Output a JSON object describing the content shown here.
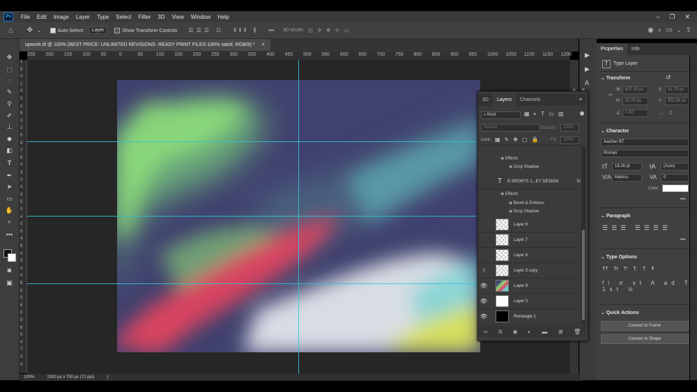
{
  "app": {
    "logo": "Ps"
  },
  "menu": [
    "File",
    "Edit",
    "Image",
    "Layer",
    "Type",
    "Select",
    "Filter",
    "3D",
    "View",
    "Window",
    "Help"
  ],
  "options": {
    "auto_select_label": "Auto-Select:",
    "auto_select_value": "Layer",
    "transform_controls_label": "Show Transform Controls",
    "mode_3d_label": "3D Mode:"
  },
  "document": {
    "tab_title": "upwork.tif @ 100% (BEST PRICE- UNLIMITED REVISIONS- READY PRINT FILES-100% satisf, RGB/8) *",
    "tab_close": "×"
  },
  "ruler": {
    "h_ticks": [
      "250",
      "200",
      "150",
      "100",
      "50",
      "0",
      "50",
      "100",
      "150",
      "200",
      "250",
      "300",
      "350",
      "400",
      "450",
      "500",
      "550",
      "600",
      "650",
      "700",
      "750",
      "800",
      "850",
      "900",
      "950",
      "1000",
      "1050",
      "1100",
      "1150",
      "1200"
    ],
    "v_ticks": [
      "1",
      "5",
      "0",
      "1",
      "0",
      "0",
      "1",
      "5",
      "0",
      "2",
      "0",
      "0",
      "2",
      "5",
      "0",
      "3",
      "0",
      "0",
      "3",
      "5",
      "0",
      "4",
      "0",
      "0",
      "4",
      "5",
      "0",
      "5",
      "0",
      "0",
      "5",
      "5",
      "0",
      "6",
      "0",
      "0",
      "6",
      "5",
      "0",
      "7",
      "0",
      "0"
    ]
  },
  "status": {
    "zoom": "100%",
    "doc_info": "1000 px x 750 px (72 ppi)",
    "arrow": ")"
  },
  "properties": {
    "tabs": [
      "Properties",
      "Info"
    ],
    "layer_kind": "Type Layer",
    "transform_title": "Transform",
    "w_label": "W:",
    "w_value": "637.33 px",
    "x_label": "X:",
    "x_value": "81.73 px",
    "h_label": "H:",
    "h_value": "20.25 px",
    "y_label": "Y:",
    "y_value": "352.56 px",
    "angle_value": "0.00°",
    "character_title": "Character",
    "font_family": "Aachen BT",
    "font_style": "Roman",
    "font_size": "18.26 pt",
    "leading": "(Auto)",
    "kerning": "Metrics",
    "tracking": "0",
    "color_label": "Color",
    "paragraph_title": "Paragraph",
    "type_options_title": "Type Options",
    "type_options_buttons": [
      "TT",
      "Tr",
      "T'",
      "T,",
      "T",
      "Ŧ"
    ],
    "quick_actions_title": "Quick Actions",
    "convert_frame": "Convert to Frame",
    "convert_shape": "Convert to Shape",
    "more": "•••"
  },
  "layers": {
    "tabs": [
      "3D",
      "Layers",
      "Channels"
    ],
    "filter_label": "Kind",
    "blend_mode": "Normal",
    "opacity_label": "Opacity:",
    "opacity_value": "100%",
    "lock_label": "Lock:",
    "fill_label": "Fill:",
    "fill_value": "100%",
    "effects_top": {
      "effects": "Effects",
      "drop_shadow": "Drop Shadow"
    },
    "text_layer": {
      "name": "E-SPORTS 1...EY DESIGN",
      "fx": "fx",
      "effects": "Effects",
      "bevel": "Bevel & Emboss",
      "drop_shadow": "Drop Shadow"
    },
    "rows": [
      {
        "name": "Layer 8",
        "visible": false
      },
      {
        "name": "Layer 7",
        "visible": false
      },
      {
        "name": "Layer 6",
        "visible": false
      },
      {
        "name": "Layer 3 copy",
        "visible": false
      },
      {
        "name": "Layer 9",
        "visible": true
      },
      {
        "name": "Layer 0",
        "visible": true
      },
      {
        "name": "Rectangle 1",
        "visible": true
      }
    ]
  },
  "colors": {
    "guide": "#2ec4d8",
    "art_base": "#40416e",
    "art_green": "#8fe07a",
    "art_red": "#e0455f",
    "art_cyan": "#6ad2d0",
    "art_yellow": "#d8e048"
  }
}
